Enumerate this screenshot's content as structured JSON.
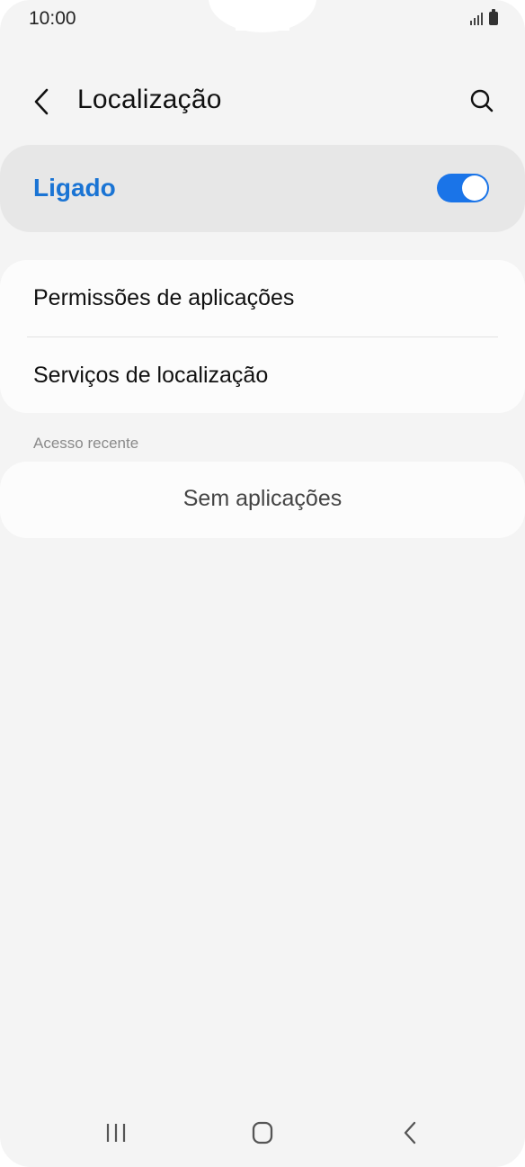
{
  "status_bar": {
    "time": "10:00",
    "icons": [
      "signal-icon",
      "battery-icon"
    ]
  },
  "header": {
    "back_icon": "chevron-left-icon",
    "title": "Localização",
    "search_icon": "search-icon"
  },
  "toggle": {
    "label": "Ligado",
    "state": "on",
    "accent_color": "#1a74e8"
  },
  "menu": {
    "items": [
      {
        "label": "Permissões de aplicações"
      },
      {
        "label": "Serviços de localização"
      }
    ]
  },
  "recent_access": {
    "header": "Acesso recente",
    "empty_text": "Sem aplicações"
  },
  "nav_bar": {
    "buttons": [
      "recent-apps-icon",
      "home-icon",
      "back-icon"
    ]
  }
}
